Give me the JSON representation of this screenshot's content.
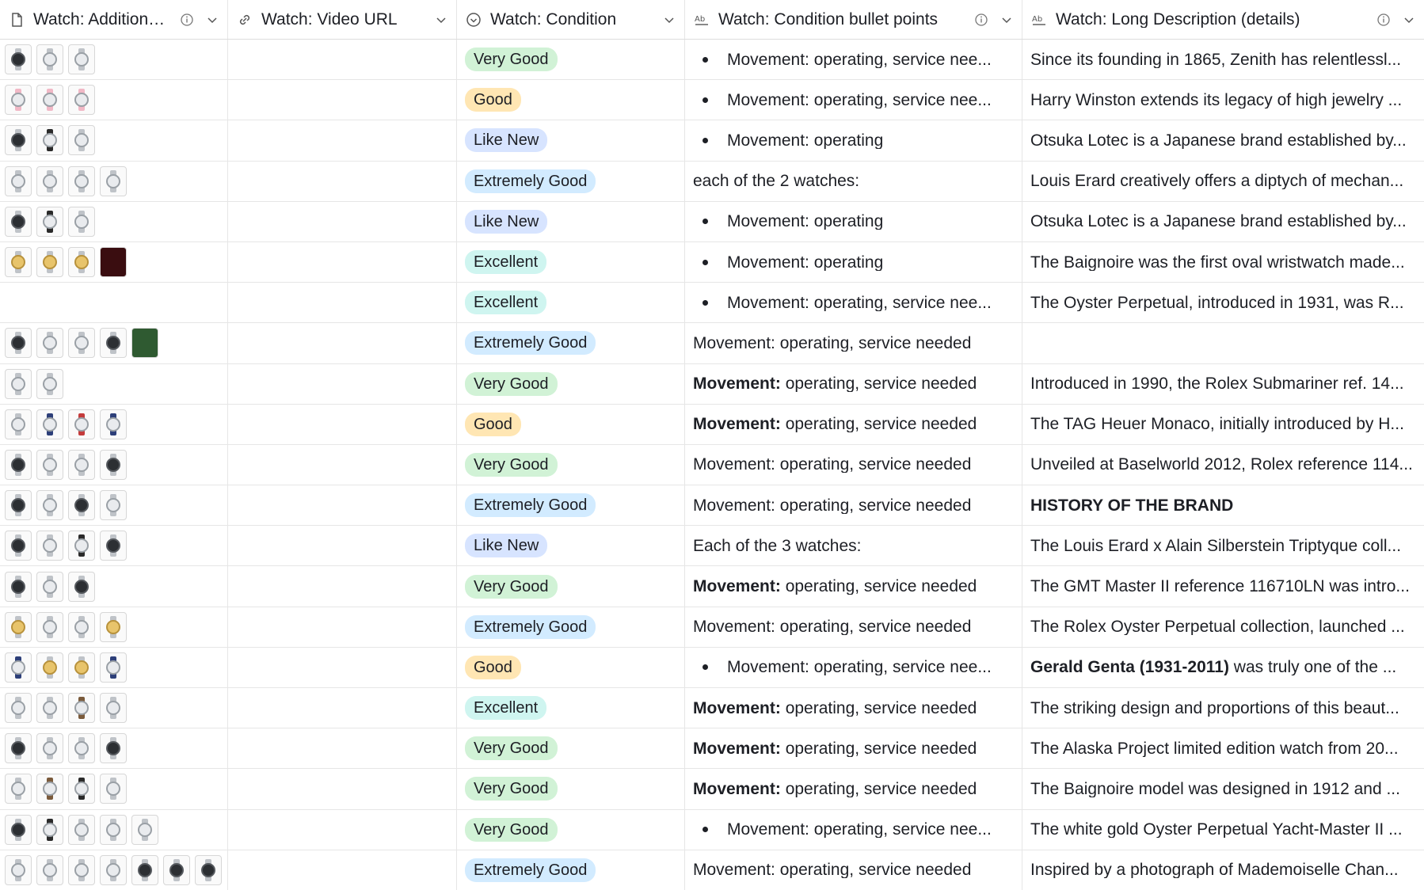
{
  "columns": [
    {
      "label": "Watch: Additional...",
      "icon": "file-icon",
      "info": true
    },
    {
      "label": "Watch: Video URL",
      "icon": "link-icon",
      "info": false
    },
    {
      "label": "Watch: Condition",
      "icon": "single-select-icon",
      "info": false
    },
    {
      "label": "Watch: Condition bullet points",
      "icon": "text-icon",
      "info": true
    },
    {
      "label": "Watch: Long Description (details)",
      "icon": "text-icon",
      "info": true
    }
  ],
  "rows": [
    {
      "thumbs": [
        "dark",
        "silver",
        "silver"
      ],
      "condition": "Very Good",
      "cond_class": "vg",
      "bullet": true,
      "bp_bold": "",
      "bp_text": "Movement: operating, service nee...",
      "desc_bold": "",
      "desc": "Since its founding in 1865, Zenith has relentlessl..."
    },
    {
      "thumbs": [
        "pink",
        "pink",
        "pink"
      ],
      "condition": "Good",
      "cond_class": "g",
      "bullet": true,
      "bp_bold": "",
      "bp_text": "Movement: operating, service nee...",
      "desc_bold": "",
      "desc": "Harry Winston extends its legacy of high jewelry ..."
    },
    {
      "thumbs": [
        "dark",
        "black",
        "silver"
      ],
      "condition": "Like New",
      "cond_class": "ln",
      "bullet": true,
      "bp_bold": "",
      "bp_text": "Movement: operating",
      "desc_bold": "",
      "desc": "Otsuka Lotec is a Japanese brand established by..."
    },
    {
      "thumbs": [
        "silver",
        "silver",
        "silver",
        "silver"
      ],
      "condition": "Extremely Good",
      "cond_class": "eg",
      "bullet": false,
      "bp_bold": "",
      "bp_text": "each of the 2 watches:",
      "desc_bold": "",
      "desc": "Louis Erard creatively offers a diptych of mechan..."
    },
    {
      "thumbs": [
        "dark",
        "black",
        "silver"
      ],
      "condition": "Like New",
      "cond_class": "ln",
      "bullet": true,
      "bp_bold": "",
      "bp_text": "Movement: operating",
      "desc_bold": "",
      "desc": "Otsuka Lotec is a Japanese brand established by..."
    },
    {
      "thumbs": [
        "gold",
        "gold",
        "gold",
        "box"
      ],
      "condition": "Excellent",
      "cond_class": "ex",
      "bullet": true,
      "bp_bold": "",
      "bp_text": "Movement: operating",
      "desc_bold": "",
      "desc": "The Baignoire was the first oval wristwatch made..."
    },
    {
      "thumbs": [],
      "condition": "Excellent",
      "cond_class": "ex",
      "bullet": true,
      "bp_bold": "",
      "bp_text": "Movement: operating, service nee...",
      "desc_bold": "",
      "desc": "The Oyster Perpetual, introduced in 1931, was R..."
    },
    {
      "thumbs": [
        "dark",
        "silver",
        "silver",
        "dark",
        "green"
      ],
      "condition": "Extremely Good",
      "cond_class": "eg",
      "bullet": false,
      "bp_bold": "",
      "bp_text": "Movement: operating, service needed",
      "desc_bold": "",
      "desc": ""
    },
    {
      "thumbs": [
        "silver",
        "silver"
      ],
      "condition": "Very Good",
      "cond_class": "vg",
      "bullet": false,
      "bp_bold": "Movement:",
      "bp_text": " operating, service needed",
      "desc_bold": "",
      "desc": "Introduced in 1990, the Rolex Submariner ref. 14..."
    },
    {
      "thumbs": [
        "silver",
        "blue",
        "red",
        "blue"
      ],
      "condition": "Good",
      "cond_class": "g",
      "bullet": false,
      "bp_bold": "Movement:",
      "bp_text": " operating, service needed",
      "desc_bold": "",
      "desc": "The TAG Heuer Monaco, initially introduced by H..."
    },
    {
      "thumbs": [
        "dark",
        "silver",
        "silver",
        "dark"
      ],
      "condition": "Very Good",
      "cond_class": "vg",
      "bullet": false,
      "bp_bold": "",
      "bp_text": "Movement: operating, service needed",
      "desc_bold": "",
      "desc": "Unveiled at Baselworld 2012, Rolex reference 114..."
    },
    {
      "thumbs": [
        "dark",
        "silver",
        "dark",
        "silver"
      ],
      "condition": "Extremely Good",
      "cond_class": "eg",
      "bullet": false,
      "bp_bold": "",
      "bp_text": "Movement: operating, service needed",
      "desc_bold": "HISTORY OF THE BRAND",
      "desc": ""
    },
    {
      "thumbs": [
        "dark",
        "silver",
        "black",
        "dark"
      ],
      "condition": "Like New",
      "cond_class": "ln",
      "bullet": false,
      "bp_bold": "",
      "bp_text": "Each of the 3 watches:",
      "desc_bold": "",
      "desc": "The Louis Erard x Alain Silberstein Triptyque coll..."
    },
    {
      "thumbs": [
        "dark",
        "silver",
        "dark"
      ],
      "condition": "Very Good",
      "cond_class": "vg",
      "bullet": false,
      "bp_bold": "Movement:",
      "bp_text": " operating, service needed",
      "desc_bold": "",
      "desc": "The GMT Master II reference 116710LN was intro..."
    },
    {
      "thumbs": [
        "gold",
        "silver",
        "silver",
        "gold"
      ],
      "condition": "Extremely Good",
      "cond_class": "eg",
      "bullet": false,
      "bp_bold": "",
      "bp_text": "Movement: operating, service needed",
      "desc_bold": "",
      "desc": "The Rolex Oyster Perpetual collection, launched ..."
    },
    {
      "thumbs": [
        "blue",
        "gold",
        "gold",
        "blue"
      ],
      "condition": "Good",
      "cond_class": "g",
      "bullet": true,
      "bp_bold": "",
      "bp_text": "Movement: operating, service nee...",
      "desc_bold": "Gerald Genta (1931-2011)",
      "desc": " was truly one of the ..."
    },
    {
      "thumbs": [
        "silver",
        "silver",
        "brown",
        "silver"
      ],
      "condition": "Excellent",
      "cond_class": "ex",
      "bullet": false,
      "bp_bold": "Movement:",
      "bp_text": " operating, service needed",
      "desc_bold": "",
      "desc": "The striking design and proportions of this beaut..."
    },
    {
      "thumbs": [
        "dark",
        "silver",
        "silver",
        "dark"
      ],
      "condition": "Very Good",
      "cond_class": "vg",
      "bullet": false,
      "bp_bold": "Movement:",
      "bp_text": " operating, service needed",
      "desc_bold": "",
      "desc": "The Alaska Project limited edition watch from 20..."
    },
    {
      "thumbs": [
        "silver",
        "brown",
        "black",
        "silver"
      ],
      "condition": "Very Good",
      "cond_class": "vg",
      "bullet": false,
      "bp_bold": "Movement:",
      "bp_text": " operating, service needed",
      "desc_bold": "",
      "desc": "The Baignoire model was designed in 1912 and ..."
    },
    {
      "thumbs": [
        "dark",
        "black",
        "silver",
        "silver",
        "silver"
      ],
      "condition": "Very Good",
      "cond_class": "vg",
      "bullet": true,
      "bp_bold": "",
      "bp_text": "Movement: operating, service nee...",
      "desc_bold": "",
      "desc": "The white gold Oyster Perpetual Yacht-Master II ..."
    },
    {
      "thumbs": [
        "silver",
        "silver",
        "silver",
        "silver",
        "dark",
        "dark",
        "dark"
      ],
      "condition": "Extremely Good",
      "cond_class": "eg",
      "bullet": false,
      "bp_bold": "",
      "bp_text": "Movement: operating, service needed",
      "desc_bold": "",
      "desc": "Inspired by a photograph of Mademoiselle Chan..."
    }
  ]
}
